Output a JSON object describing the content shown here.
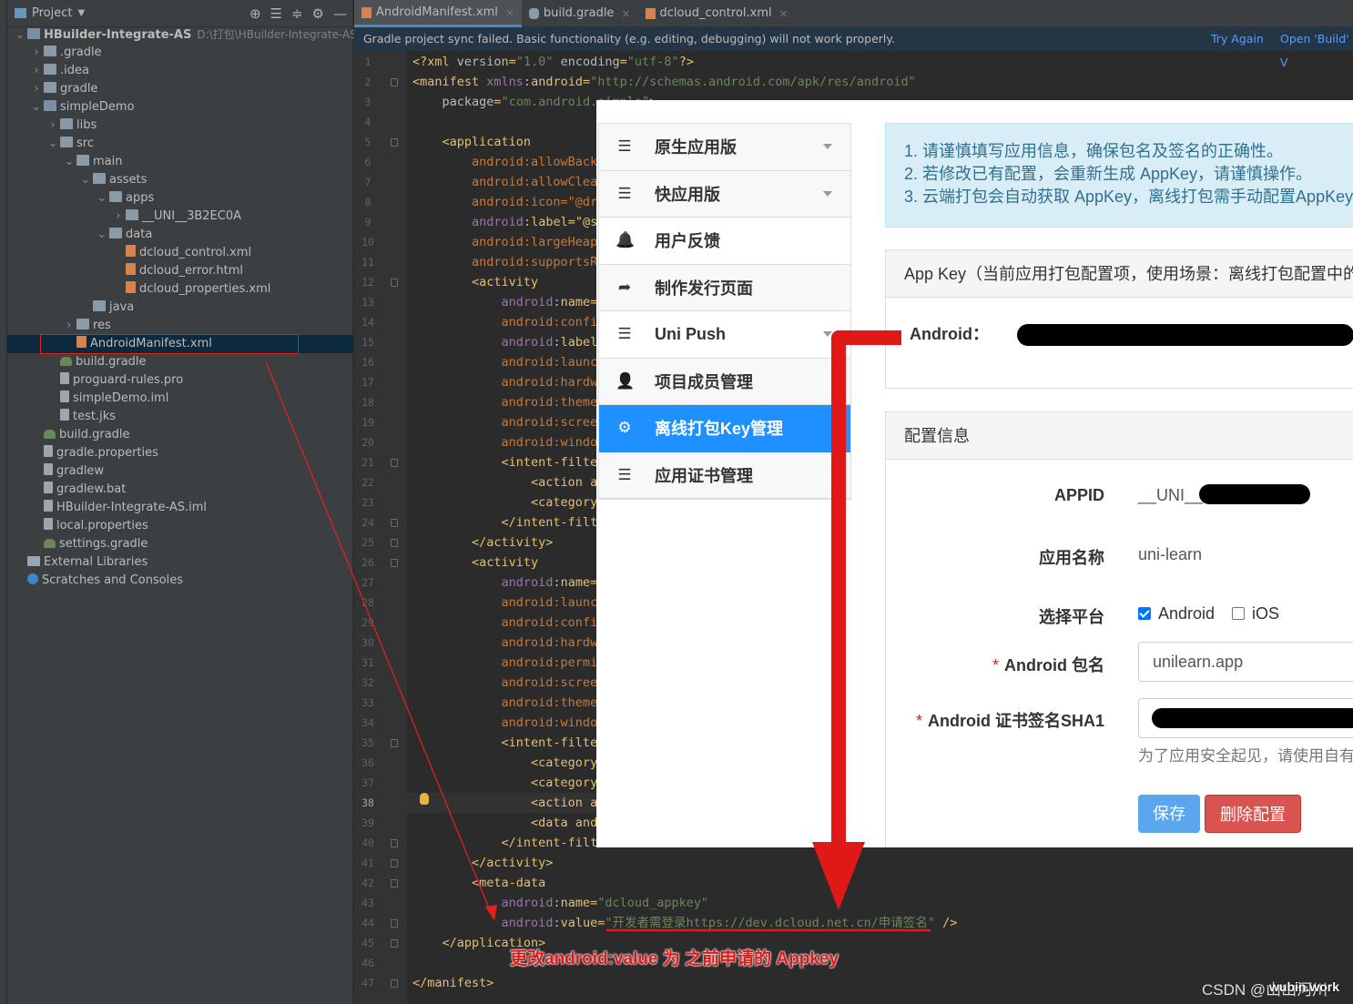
{
  "project_panel": {
    "title": "Project",
    "tree": [
      {
        "label": "HBuilder-Integrate-AS",
        "extra": "D:\\打包\\HBuilder-Integrate-AS",
        "icon": "module-folder-icon",
        "expanded": true
      },
      {
        "label": ".gradle",
        "icon": "folder-icon"
      },
      {
        "label": ".idea",
        "icon": "folder-icon"
      },
      {
        "label": "gradle",
        "icon": "folder-icon"
      },
      {
        "label": "simpleDemo",
        "icon": "module-folder-icon",
        "expanded": true
      },
      {
        "label": "libs",
        "icon": "folder-icon"
      },
      {
        "label": "src",
        "icon": "folder-icon",
        "expanded": true
      },
      {
        "label": "main",
        "icon": "folder-icon",
        "expanded": true
      },
      {
        "label": "assets",
        "icon": "folder-icon",
        "expanded": true
      },
      {
        "label": "apps",
        "icon": "folder-icon",
        "expanded": true
      },
      {
        "label": "__UNI__3B2EC0A",
        "icon": "folder-icon"
      },
      {
        "label": "data",
        "icon": "folder-icon",
        "expanded": true
      },
      {
        "label": "dcloud_control.xml",
        "icon": "xml-file-icon"
      },
      {
        "label": "dcloud_error.html",
        "icon": "html-file-icon"
      },
      {
        "label": "dcloud_properties.xml",
        "icon": "xml-file-icon"
      },
      {
        "label": "java",
        "icon": "folder-icon"
      },
      {
        "label": "res",
        "icon": "folder-icon"
      },
      {
        "label": "AndroidManifest.xml",
        "icon": "manifest-file-icon",
        "selected": true
      },
      {
        "label": "build.gradle",
        "icon": "gradle-icon"
      },
      {
        "label": "proguard-rules.pro",
        "icon": "file-icon"
      },
      {
        "label": "simpleDemo.iml",
        "icon": "file-icon"
      },
      {
        "label": "test.jks",
        "icon": "file-icon"
      },
      {
        "label": "build.gradle",
        "icon": "gradle-icon"
      },
      {
        "label": "gradle.properties",
        "icon": "file-icon"
      },
      {
        "label": "gradlew",
        "icon": "file-icon"
      },
      {
        "label": "gradlew.bat",
        "icon": "file-icon"
      },
      {
        "label": "HBuilder-Integrate-AS.iml",
        "icon": "file-icon"
      },
      {
        "label": "local.properties",
        "icon": "file-icon"
      },
      {
        "label": "settings.gradle",
        "icon": "gradle-icon"
      },
      {
        "label": "External Libraries",
        "icon": "library-icon"
      },
      {
        "label": "Scratches and Consoles",
        "icon": "scratch-icon"
      }
    ]
  },
  "editor": {
    "tabs": [
      "AndroidManifest.xml",
      "build.gradle",
      "dcloud_control.xml"
    ],
    "notification": {
      "message": "Gradle project sync failed. Basic functionality (e.g. editing, debugging) will not work properly.",
      "try_again": "Try Again",
      "open_build": "Open 'Build' V"
    },
    "current_line": 38,
    "lines": [
      "<?xml version=\"1.0\" encoding=\"utf-8\"?>",
      "<manifest xmlns:android=\"http://schemas.android.com/apk/res/android\"",
      "    package=\"com.android.simple\">",
      "",
      "    <application",
      "        android:allowBack",
      "        android:allowClea",
      "        android:icon=\"@dra",
      "        android:label=\"@st",
      "        android:largeHeap",
      "        android:supportsR",
      "        <activity",
      "            android:name=",
      "            android:confi",
      "            android:label",
      "            android:launc",
      "            android:hardw",
      "            android:theme",
      "            android:scree",
      "            android:windo",
      "            <intent-filte",
      "                <action a",
      "                <category",
      "            </intent-filt",
      "        </activity>",
      "        <activity",
      "            android:name=",
      "            android:launc",
      "            android:confi",
      "            android:hardw",
      "            android:permi",
      "            android:scree",
      "            android:theme",
      "            android:windo",
      "            <intent-filte",
      "                <category",
      "                <category",
      "                <action a",
      "                <data and",
      "            </intent-filt",
      "        </activity>",
      "        <meta-data",
      "            android:name=\"dcloud_appkey\"",
      "            android:value=\"开发者需登录https://dev.dcloud.net.cn/申请签名\" />",
      "    </application>",
      "",
      "</manifest>"
    ]
  },
  "overlay": {
    "menu": [
      {
        "label": "原生应用版",
        "icon": "list-icon",
        "caret": true
      },
      {
        "label": "快应用版",
        "icon": "list-icon",
        "caret": true
      },
      {
        "label": "用户反馈",
        "icon": "bell-icon"
      },
      {
        "label": "制作发行页面",
        "icon": "share-icon"
      },
      {
        "label": "Uni Push",
        "icon": "list-icon",
        "caret": true
      },
      {
        "label": "项目成员管理",
        "icon": "user-icon"
      },
      {
        "label": "离线打包Key管理",
        "icon": "gear-icon",
        "active": true
      },
      {
        "label": "应用证书管理",
        "icon": "list-icon"
      }
    ],
    "alert": [
      "1. 请谨慎填写应用信息，确保包名及签名的正确性。",
      "2. 若修改已有配置，会重新生成 AppKey，请谨慎操作。",
      "3. 云端打包会自动获取 AppKey，离线打包需手动配置AppKey，"
    ],
    "appkey_panel": {
      "title": "App Key（当前应用打包配置项，使用场景：离线打包配置中的A",
      "android_label": "Android："
    },
    "config_panel": {
      "title": "配置信息",
      "appid_label": "APPID",
      "appid_value": "__UNI__",
      "app_name_label": "应用名称",
      "app_name_value": "uni-learn",
      "platform_label": "选择平台",
      "platform_android": "Android",
      "platform_ios": "iOS",
      "package_label": "Android 包名",
      "package_value": "unilearn.app",
      "sha1_label": "Android 证书签名SHA1",
      "hint": "为了应用安全起见，请使用自有",
      "save_button": "保存",
      "delete_button": "删除配置"
    }
  },
  "annotation": {
    "note": "更改android:value 为 之前申请的 Appkey",
    "watermark": "CSDN @山山河川",
    "watermark_author": "wubin.work"
  },
  "colors": {
    "annotation_red": "#e01818",
    "menu_active": "#1e90ff",
    "save_button": "#5aa7ef",
    "delete_button": "#d9534f"
  }
}
